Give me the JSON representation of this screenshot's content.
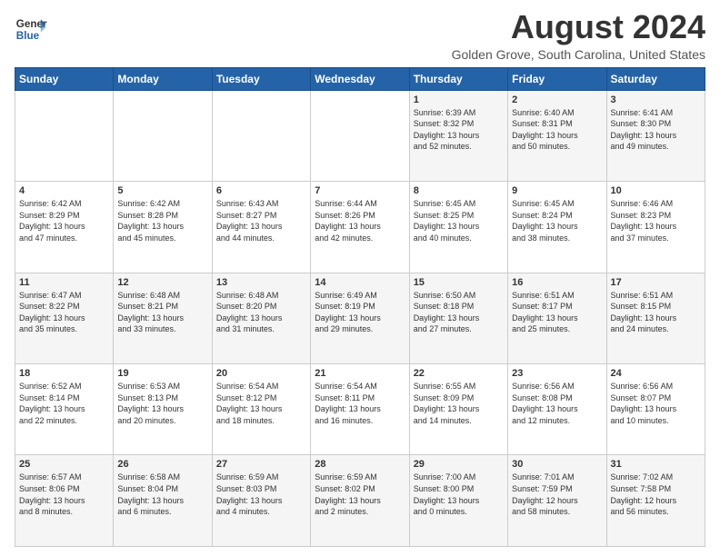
{
  "logo": {
    "general": "General",
    "blue": "Blue"
  },
  "header": {
    "title": "August 2024",
    "subtitle": "Golden Grove, South Carolina, United States"
  },
  "days": [
    "Sunday",
    "Monday",
    "Tuesday",
    "Wednesday",
    "Thursday",
    "Friday",
    "Saturday"
  ],
  "weeks": [
    [
      {
        "day": "",
        "data": ""
      },
      {
        "day": "",
        "data": ""
      },
      {
        "day": "",
        "data": ""
      },
      {
        "day": "",
        "data": ""
      },
      {
        "day": "1",
        "data": "Sunrise: 6:39 AM\nSunset: 8:32 PM\nDaylight: 13 hours\nand 52 minutes."
      },
      {
        "day": "2",
        "data": "Sunrise: 6:40 AM\nSunset: 8:31 PM\nDaylight: 13 hours\nand 50 minutes."
      },
      {
        "day": "3",
        "data": "Sunrise: 6:41 AM\nSunset: 8:30 PM\nDaylight: 13 hours\nand 49 minutes."
      }
    ],
    [
      {
        "day": "4",
        "data": "Sunrise: 6:42 AM\nSunset: 8:29 PM\nDaylight: 13 hours\nand 47 minutes."
      },
      {
        "day": "5",
        "data": "Sunrise: 6:42 AM\nSunset: 8:28 PM\nDaylight: 13 hours\nand 45 minutes."
      },
      {
        "day": "6",
        "data": "Sunrise: 6:43 AM\nSunset: 8:27 PM\nDaylight: 13 hours\nand 44 minutes."
      },
      {
        "day": "7",
        "data": "Sunrise: 6:44 AM\nSunset: 8:26 PM\nDaylight: 13 hours\nand 42 minutes."
      },
      {
        "day": "8",
        "data": "Sunrise: 6:45 AM\nSunset: 8:25 PM\nDaylight: 13 hours\nand 40 minutes."
      },
      {
        "day": "9",
        "data": "Sunrise: 6:45 AM\nSunset: 8:24 PM\nDaylight: 13 hours\nand 38 minutes."
      },
      {
        "day": "10",
        "data": "Sunrise: 6:46 AM\nSunset: 8:23 PM\nDaylight: 13 hours\nand 37 minutes."
      }
    ],
    [
      {
        "day": "11",
        "data": "Sunrise: 6:47 AM\nSunset: 8:22 PM\nDaylight: 13 hours\nand 35 minutes."
      },
      {
        "day": "12",
        "data": "Sunrise: 6:48 AM\nSunset: 8:21 PM\nDaylight: 13 hours\nand 33 minutes."
      },
      {
        "day": "13",
        "data": "Sunrise: 6:48 AM\nSunset: 8:20 PM\nDaylight: 13 hours\nand 31 minutes."
      },
      {
        "day": "14",
        "data": "Sunrise: 6:49 AM\nSunset: 8:19 PM\nDaylight: 13 hours\nand 29 minutes."
      },
      {
        "day": "15",
        "data": "Sunrise: 6:50 AM\nSunset: 8:18 PM\nDaylight: 13 hours\nand 27 minutes."
      },
      {
        "day": "16",
        "data": "Sunrise: 6:51 AM\nSunset: 8:17 PM\nDaylight: 13 hours\nand 25 minutes."
      },
      {
        "day": "17",
        "data": "Sunrise: 6:51 AM\nSunset: 8:15 PM\nDaylight: 13 hours\nand 24 minutes."
      }
    ],
    [
      {
        "day": "18",
        "data": "Sunrise: 6:52 AM\nSunset: 8:14 PM\nDaylight: 13 hours\nand 22 minutes."
      },
      {
        "day": "19",
        "data": "Sunrise: 6:53 AM\nSunset: 8:13 PM\nDaylight: 13 hours\nand 20 minutes."
      },
      {
        "day": "20",
        "data": "Sunrise: 6:54 AM\nSunset: 8:12 PM\nDaylight: 13 hours\nand 18 minutes."
      },
      {
        "day": "21",
        "data": "Sunrise: 6:54 AM\nSunset: 8:11 PM\nDaylight: 13 hours\nand 16 minutes."
      },
      {
        "day": "22",
        "data": "Sunrise: 6:55 AM\nSunset: 8:09 PM\nDaylight: 13 hours\nand 14 minutes."
      },
      {
        "day": "23",
        "data": "Sunrise: 6:56 AM\nSunset: 8:08 PM\nDaylight: 13 hours\nand 12 minutes."
      },
      {
        "day": "24",
        "data": "Sunrise: 6:56 AM\nSunset: 8:07 PM\nDaylight: 13 hours\nand 10 minutes."
      }
    ],
    [
      {
        "day": "25",
        "data": "Sunrise: 6:57 AM\nSunset: 8:06 PM\nDaylight: 13 hours\nand 8 minutes."
      },
      {
        "day": "26",
        "data": "Sunrise: 6:58 AM\nSunset: 8:04 PM\nDaylight: 13 hours\nand 6 minutes."
      },
      {
        "day": "27",
        "data": "Sunrise: 6:59 AM\nSunset: 8:03 PM\nDaylight: 13 hours\nand 4 minutes."
      },
      {
        "day": "28",
        "data": "Sunrise: 6:59 AM\nSunset: 8:02 PM\nDaylight: 13 hours\nand 2 minutes."
      },
      {
        "day": "29",
        "data": "Sunrise: 7:00 AM\nSunset: 8:00 PM\nDaylight: 13 hours\nand 0 minutes."
      },
      {
        "day": "30",
        "data": "Sunrise: 7:01 AM\nSunset: 7:59 PM\nDaylight: 12 hours\nand 58 minutes."
      },
      {
        "day": "31",
        "data": "Sunrise: 7:02 AM\nSunset: 7:58 PM\nDaylight: 12 hours\nand 56 minutes."
      }
    ]
  ]
}
